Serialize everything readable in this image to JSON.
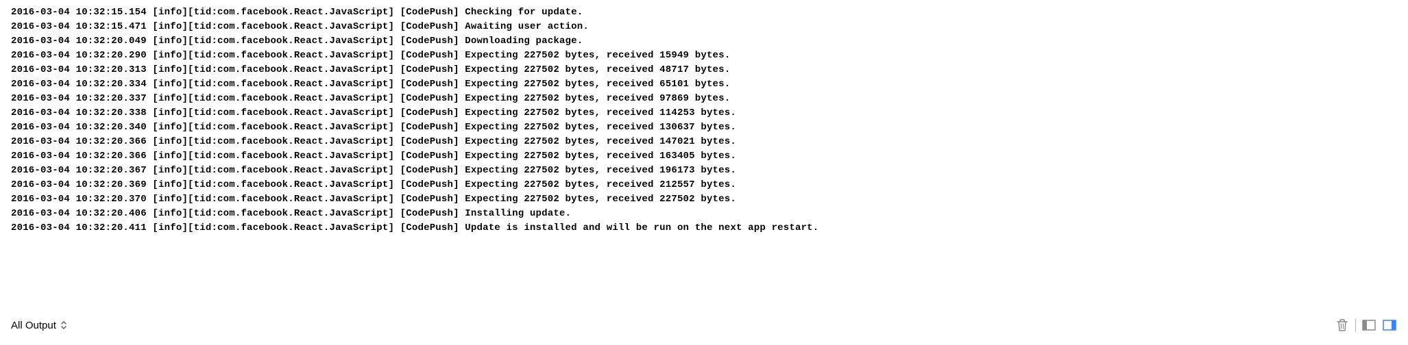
{
  "filter": {
    "label": "All Output"
  },
  "log": {
    "lines": [
      "2016-03-04 10:32:15.154 [info][tid:com.facebook.React.JavaScript] [CodePush] Checking for update.",
      "2016-03-04 10:32:15.471 [info][tid:com.facebook.React.JavaScript] [CodePush] Awaiting user action.",
      "2016-03-04 10:32:20.049 [info][tid:com.facebook.React.JavaScript] [CodePush] Downloading package.",
      "2016-03-04 10:32:20.290 [info][tid:com.facebook.React.JavaScript] [CodePush] Expecting 227502 bytes, received 15949 bytes.",
      "2016-03-04 10:32:20.313 [info][tid:com.facebook.React.JavaScript] [CodePush] Expecting 227502 bytes, received 48717 bytes.",
      "2016-03-04 10:32:20.334 [info][tid:com.facebook.React.JavaScript] [CodePush] Expecting 227502 bytes, received 65101 bytes.",
      "2016-03-04 10:32:20.337 [info][tid:com.facebook.React.JavaScript] [CodePush] Expecting 227502 bytes, received 97869 bytes.",
      "2016-03-04 10:32:20.338 [info][tid:com.facebook.React.JavaScript] [CodePush] Expecting 227502 bytes, received 114253 bytes.",
      "2016-03-04 10:32:20.340 [info][tid:com.facebook.React.JavaScript] [CodePush] Expecting 227502 bytes, received 130637 bytes.",
      "2016-03-04 10:32:20.366 [info][tid:com.facebook.React.JavaScript] [CodePush] Expecting 227502 bytes, received 147021 bytes.",
      "2016-03-04 10:32:20.366 [info][tid:com.facebook.React.JavaScript] [CodePush] Expecting 227502 bytes, received 163405 bytes.",
      "2016-03-04 10:32:20.367 [info][tid:com.facebook.React.JavaScript] [CodePush] Expecting 227502 bytes, received 196173 bytes.",
      "2016-03-04 10:32:20.369 [info][tid:com.facebook.React.JavaScript] [CodePush] Expecting 227502 bytes, received 212557 bytes.",
      "2016-03-04 10:32:20.370 [info][tid:com.facebook.React.JavaScript] [CodePush] Expecting 227502 bytes, received 227502 bytes.",
      "2016-03-04 10:32:20.406 [info][tid:com.facebook.React.JavaScript] [CodePush] Installing update.",
      "2016-03-04 10:32:20.411 [info][tid:com.facebook.React.JavaScript] [CodePush] Update is installed and will be run on the next app restart."
    ]
  },
  "icons": {
    "trash": "trash-icon",
    "panel_left": "panel-left-icon",
    "panel_right": "panel-right-icon"
  },
  "colors": {
    "active_blue": "#3b82f6",
    "icon_gray": "#8a8a8a"
  }
}
